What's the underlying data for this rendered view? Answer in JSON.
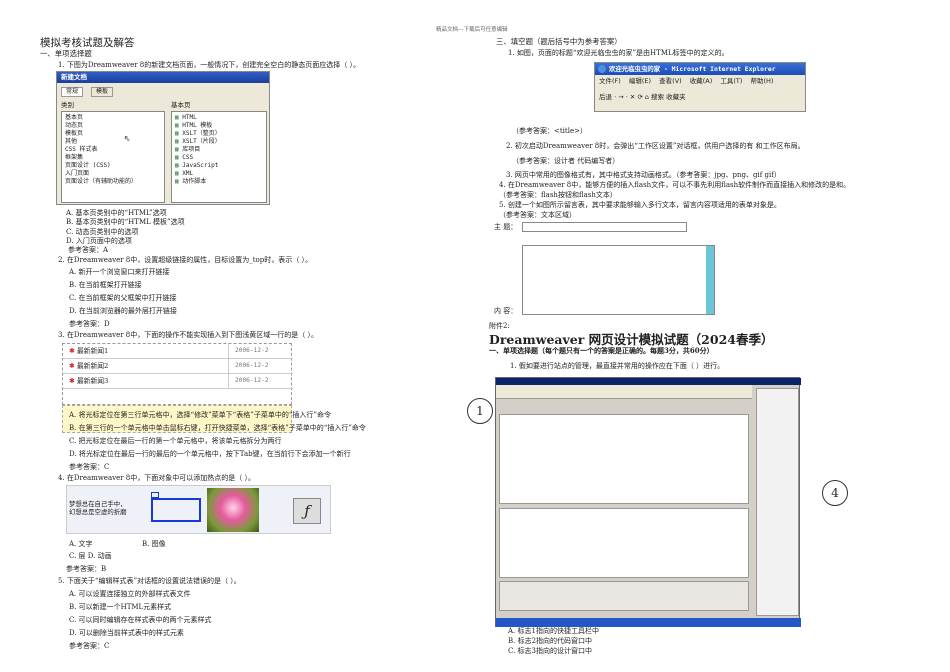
{
  "header": "精品文档---下载后可任意编辑",
  "title": "模拟考核试题及解答",
  "left": {
    "section1": "一、单项选择题",
    "q1": "1.  下图为Dreamweaver 8的新建文档页面，一般情况下，创建完全空白的静态页面应选择（    ）。",
    "newdoc": {
      "title": "新建文档",
      "tabs": [
        "常规",
        "模板"
      ],
      "cat_label": "类别",
      "basic_label": "基本页",
      "categories": [
        "基本页",
        "动态页",
        "模板页",
        "其他",
        "CSS 样式表",
        "框架集",
        "页面设计 (CSS)",
        "入门页面",
        "页面设计（有辅助功能的）"
      ],
      "pages": [
        "HTML",
        "HTML 模板",
        "XSLT（整页）",
        "XSLT（片段）",
        "库项目",
        "CSS",
        "JavaScript",
        "XML",
        "动作脚本"
      ]
    },
    "q1_options": [
      "A.  基本页类别中的“HTML”选项",
      "B.  基本页类别中的“HTML 模板”选项",
      "C.  动态页类别中的选项",
      "D.  入门页面中的选项"
    ],
    "q1_answer": "参考答案：A",
    "q2": "2.  在Dreamweaver 8中，设置超级链接的属性，目标设置为_top时，表示（    ）。",
    "q2_options": [
      "A. 新开一个浏览窗口来打开链接",
      "B. 在当前框架打开链接",
      "C. 在当前框架的父框架中打开链接",
      "D. 在当前浏览器的最外层打开链接"
    ],
    "q2_answer": "参考答案：D",
    "q3": "3.  在Dreamweaver 8中，下面的操作不能实现插入到下图浅黄区域一行的是（    ）。",
    "news": [
      {
        "title": "最新新闻1",
        "date": "2006-12-2"
      },
      {
        "title": "最新新闻2",
        "date": "2006-12-2"
      },
      {
        "title": "最新新闻3",
        "date": "2006-12-2"
      }
    ],
    "q3_options": [
      "A. 将光标定位在第三行单元格中，选择“修改”菜单下“表格”子菜单中的“插入行”命令",
      "B. 在第三行的一个单元格中单击鼠标右键，打开快捷菜单，选择“表格”子菜单中的“插入行”命令",
      "C. 把光标定位在最后一行的第一个单元格中，将该单元格拆分为两行",
      "D. 将光标定位在最后一行的最后的一个单元格中，按下Tab键，在当前行下会添加一个新行"
    ],
    "q3_answer": "参考答案：C",
    "q4": "4.  在Dreamweaver 8中，下面对象中可以添加热点的是（    ）。",
    "q4_imgtext": "梦想总在自己手中，幻想总是空虚的折磨",
    "q4_options": [
      "A.  文字",
      "B.  图像",
      "C.  层 D.  动画"
    ],
    "q4_answer": "参考答案：B",
    "q5": "5. 下面关于“编辑样式表”对话框的设置说法错误的是（    ）。",
    "q5_options": [
      "A.  可以设置连接独立的外部样式表文件",
      "B.  可以新建一个HTML元素样式",
      "C.  可以同时编辑存在样式表中的两个元素样式",
      "D.  可以删除当前样式表中的样式元素"
    ],
    "q5_answer": "参考答案：C"
  },
  "right": {
    "section3": "三、填空题（题后括号中为参考答案）",
    "f1": "1.  如图，页面的标题“欢迎光临虫虫的家”是由HTML标签中的定义的。",
    "ie": {
      "title": "欢迎光临虫虫的家 - Microsoft Internet Explorer",
      "menu": [
        "文件(F)",
        "编辑(E)",
        "查看(V)",
        "收藏(A)",
        "工具(T)",
        "帮助(H)"
      ],
      "toolbar": "后退 ·  →  ·  ✕  ⟳  ⌂   搜索   收藏夹"
    },
    "f1_answer": "（参考答案：<title>）",
    "f2": "2. 初次启动Dreamweaver 8时，会弹出“工作区设置”对话框，供用户选择的有 和工作区布局。",
    "f2_answer": "（参考答案：设计者    代码编写者）",
    "f3": "3. 网页中常用的图像格式有，其中格式支持动画格式。（参考答案：jpg、png、gif   gif）",
    "f4": "4. 在Dreamweaver 8中，能够方便的插入flash文件，可以不事先利用flash软件制作而直接插入和修改的是和。",
    "f4_answer": "（参考答案：flash按钮和flash文本）",
    "f5": "5. 创建一个如图所示留言表，其中要求能够输入多行文本，留言内容项适用的表单对象是。",
    "f5_answer": "（参考答案：文本区域）",
    "form_subject": "主  题：",
    "form_content": "内  容：",
    "appendix": "附件2:",
    "big_title": "Dreamweaver 网页设计模拟试题（2024春季）",
    "section1": "一、单项选择题（每个题只有一个的答案是正确的。每题3分，共60分）",
    "r_q1": "1.      假如要进行站点的管理，最直接并常用的操作应在下面（    ）进行。",
    "circle1": "1",
    "circle4": "4",
    "r_options": [
      "A.    标志1指向的快捷工具栏中",
      "B.    标志2指向的代码窗口中",
      "C.    标志3指向的设计窗口中"
    ]
  }
}
